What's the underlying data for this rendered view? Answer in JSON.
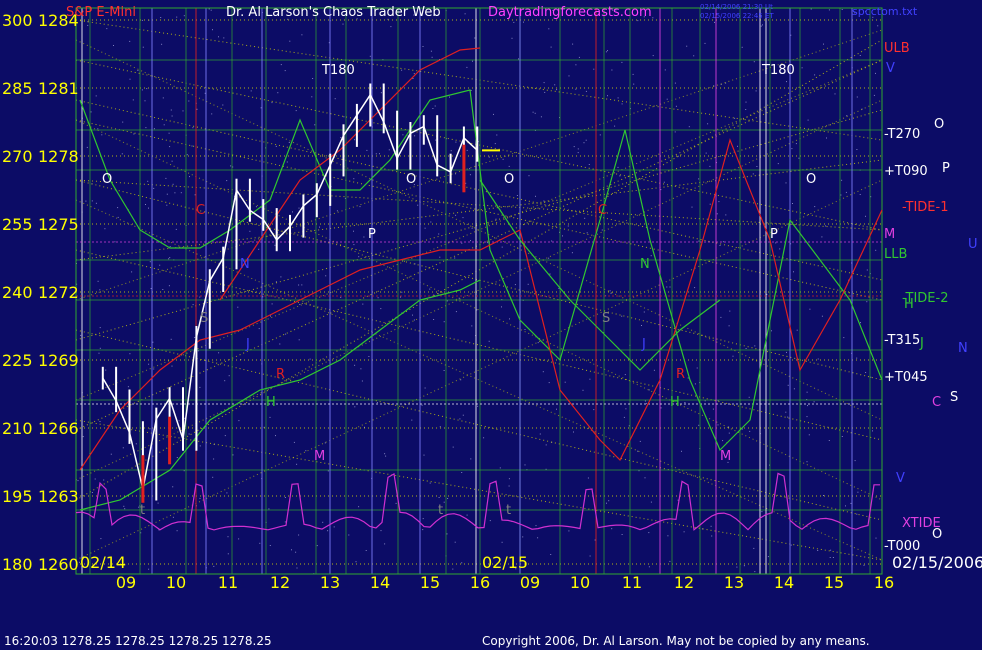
{
  "header": {
    "symbol": "S&P E-Mini",
    "title": "Dr. Al Larson's Chaos Trader Web",
    "site": "Daytradingforecasts.com",
    "stamp1": "02/14/2006 21:30 Ut",
    "stamp2": "02/15/2006 22:45 ET",
    "filename": "spcctom.txt"
  },
  "footer": {
    "quote": "16:20:03  1278.25 1278.25 1278.25 1278.25",
    "copyright": "Copyright 2006, Dr. Al Larson. May not be copied by any means."
  },
  "colors": {
    "background": "#0c0c66",
    "axis_text": "#ffff00",
    "yellow_grid": "#e0e000",
    "green_grid": "#30a830",
    "price_bar": "#ffffff",
    "red_line": "#e02020",
    "green_line": "#30c830",
    "xtide": "#d030d0",
    "magenta": "#e040e0",
    "header_red": "#ff3030",
    "header_white": "#ffffff",
    "header_magenta": "#ff40ff",
    "stamp_blue": "#4040ff",
    "footer_white": "#ffffff"
  },
  "chart_data": {
    "type": "line",
    "title": "Dr. Al Larson's Chaos Trader Web",
    "y_left_ticks": [
      "300",
      "285",
      "270",
      "255",
      "240",
      "225",
      "210",
      "195",
      "180"
    ],
    "y_price_ticks": [
      "1284",
      "1281",
      "1278",
      "1275",
      "1272",
      "1269",
      "1266",
      "1263",
      "1260"
    ],
    "ylim": [
      1260,
      1284
    ],
    "x_ticks": [
      "09",
      "10",
      "11",
      "12",
      "13",
      "14",
      "15",
      "16",
      "09",
      "10",
      "11",
      "12",
      "13",
      "14",
      "15",
      "16"
    ],
    "date_labels": [
      "02/14",
      "02/15",
      "02/15/2006"
    ],
    "right_labels": [
      "ULB",
      "V",
      "-T270",
      "O",
      "+T090",
      "P",
      "-TIDE-1",
      "M",
      "U",
      "LLB",
      "-TIDE-2",
      "H",
      "-T315",
      "J",
      "N",
      "+T045",
      "C",
      "S",
      "V",
      "XTIDE",
      "-T000",
      "O"
    ],
    "annotations": [
      "T180",
      "T180",
      "O",
      "O",
      "O",
      "O",
      "P",
      "P",
      "N",
      "N",
      "S",
      "S",
      "C",
      "C",
      "R",
      "R",
      "H",
      "H",
      "M",
      "M",
      "J",
      "J",
      "t",
      "t",
      "t"
    ],
    "price_series": {
      "name": "S&P E-Mini",
      "x": [
        9.0,
        9.25,
        9.5,
        9.75,
        10.0,
        10.25,
        10.5,
        10.75,
        11.0,
        11.25,
        11.5,
        11.75,
        12.0,
        12.25,
        12.5,
        12.75,
        13.0,
        13.25,
        13.5,
        13.75,
        14.0,
        14.25,
        14.5,
        14.75,
        15.0,
        15.25,
        15.5,
        15.75,
        16.0
      ],
      "close": [
        1268.2,
        1267.2,
        1265.8,
        1263.3,
        1266.4,
        1267.3,
        1265.5,
        1270.0,
        1272.5,
        1273.5,
        1276.5,
        1275.6,
        1275.2,
        1274.3,
        1274.9,
        1275.8,
        1276.3,
        1277.6,
        1278.9,
        1279.8,
        1280.7,
        1279.5,
        1277.9,
        1279.0,
        1279.3,
        1277.6,
        1277.3,
        1278.8,
        1278.25
      ]
    },
    "x_axis_hours": [
      "9",
      "10",
      "11",
      "12",
      "13",
      "14",
      "15",
      "16",
      "9",
      "10",
      "11",
      "12",
      "13",
      "14",
      "15",
      "16"
    ]
  }
}
